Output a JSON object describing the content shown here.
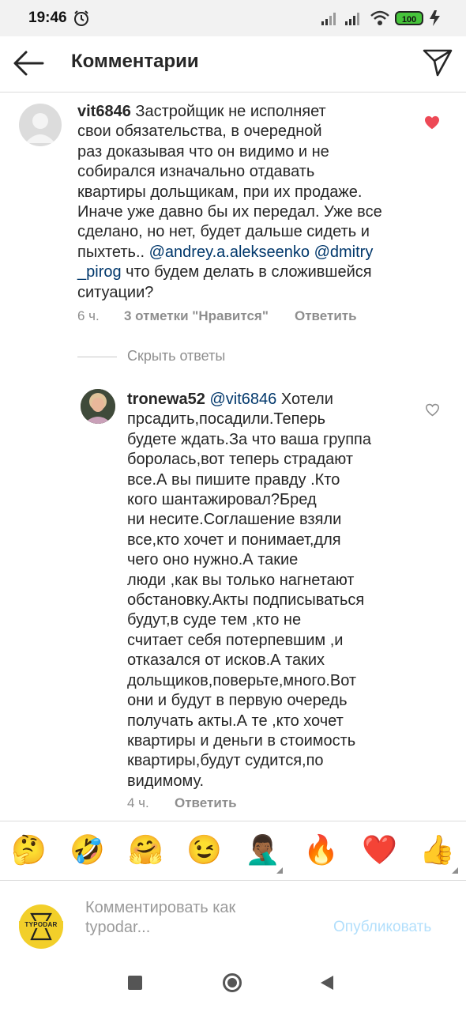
{
  "status_bar": {
    "time": "19:46",
    "battery": "100"
  },
  "header": {
    "title": "Комментарии"
  },
  "comments": [
    {
      "username": "vit6846",
      "lines": [
        {
          "user": "vit6846",
          "text": " Застройщик не исполняет"
        },
        {
          "text": "свои обязательства, в очередной"
        },
        {
          "text": "раз доказывая что он видимо и не"
        },
        {
          "text": "собирался изначально отдавать"
        },
        {
          "text": "квартиры дольщикам, при их продаже."
        },
        {
          "text": "Иначе уже давно бы их передал. Уже все"
        },
        {
          "text": "сделано, но нет, будет дальше сидеть и"
        },
        {
          "text": "пыхтеть.. ",
          "mention": "@andrey.a.alekseenko @dmitry"
        },
        {
          "mention": "_pirog",
          "text": " что будем делать в сложившейся"
        },
        {
          "text": "ситуации?"
        }
      ],
      "time": "6 ч.",
      "likes": "3 отметки \"Нравится\"",
      "reply": "Ответить",
      "liked": true
    },
    {
      "username": "tronewa52",
      "lines": [
        {
          "user": "tronewa52",
          "mention": " @vit6846",
          "text": " Хотели"
        },
        {
          "text": "прсадить,посадили.Теперь"
        },
        {
          "text": "будете ждать.За что ваша группа"
        },
        {
          "text": "боролась,вот теперь страдают"
        },
        {
          "text": "все.А вы пишите правду .Кто"
        },
        {
          "text": "кого шантажировал?Бред"
        },
        {
          "text": "ни несите.Соглашение взяли"
        },
        {
          "text": "все,кто хочет и понимает,для"
        },
        {
          "text": "чего оно нужно.А такие"
        },
        {
          "text": "люди ,как вы только нагнетают"
        },
        {
          "text": "обстановку.Акты подписываться"
        },
        {
          "text": "будут,в суде  тем ,кто не"
        },
        {
          "text": "считает себя потерпевшим ,и"
        },
        {
          "text": "отказался от исков.А таких"
        },
        {
          "text": "дольщиков,поверьте,много.Вот"
        },
        {
          "text": "они и будут в первую очередь"
        },
        {
          "text": "получать акты.А те ,кто хочет"
        },
        {
          "text": "квартиры и деньги в стоимость"
        },
        {
          "text": "квартиры,будут судится,по"
        },
        {
          "text": "видимому."
        }
      ],
      "time": "4 ч.",
      "reply": "Ответить",
      "liked": false
    }
  ],
  "hide_replies": "Скрыть ответы",
  "emoji_bar": [
    "🤔",
    "🤣",
    "🤗",
    "😉",
    "🤦🏾‍♂️",
    "🔥",
    "❤️",
    "👍"
  ],
  "input": {
    "brand": "TYPODAR",
    "placeholder": "Комментировать как typodar...",
    "placeholder_line1": "Комментировать как",
    "placeholder_line2": "typodar...",
    "publish": "Опубликовать"
  },
  "colors": {
    "like_red": "#ed4956",
    "mention": "#00376b",
    "publish_disabled": "#b2dffc",
    "brand_yellow": "#f2cf2a"
  }
}
